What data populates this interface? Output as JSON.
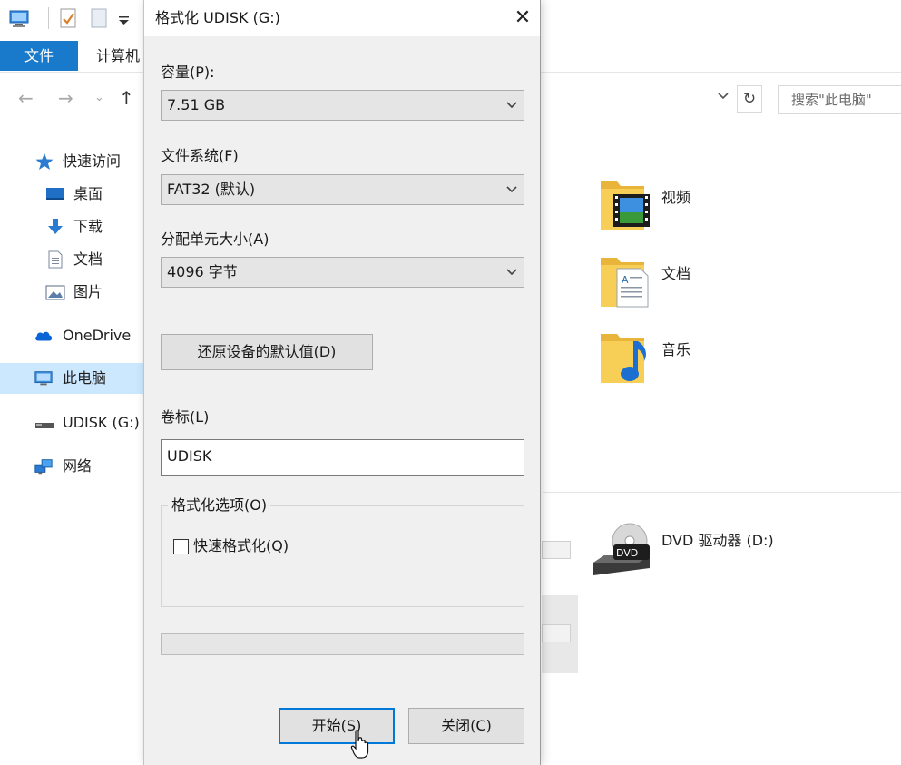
{
  "explorer": {
    "ribbon": {
      "file_tab": "文件",
      "computer_tab": "计算机"
    },
    "search": {
      "placeholder": "搜索\"此电脑\""
    },
    "sidebar": {
      "items": [
        {
          "label": "快速访问",
          "icon": "star-icon"
        },
        {
          "label": "桌面",
          "icon": "desktop-icon"
        },
        {
          "label": "下载",
          "icon": "download-arrow-icon"
        },
        {
          "label": "文档",
          "icon": "document-icon"
        },
        {
          "label": "图片",
          "icon": "picture-icon"
        },
        {
          "label": "OneDrive",
          "icon": "cloud-icon"
        },
        {
          "label": "此电脑",
          "icon": "computer-icon"
        },
        {
          "label": "UDISK (G:)",
          "icon": "usb-drive-icon"
        },
        {
          "label": "网络",
          "icon": "network-icon"
        }
      ]
    },
    "folders": [
      {
        "label": "视频",
        "icon": "video-folder-icon"
      },
      {
        "label": "文档",
        "icon": "documents-folder-icon"
      },
      {
        "label": "音乐",
        "icon": "music-folder-icon"
      }
    ],
    "drives": [
      {
        "label": "DVD 驱动器 (D:)",
        "icon": "dvd-drive-icon",
        "badge": "DVD"
      }
    ]
  },
  "dialog": {
    "title": "格式化 UDISK (G:)",
    "close_glyph": "✕",
    "capacity": {
      "label": "容量(P):",
      "value": "7.51 GB"
    },
    "filesystem": {
      "label": "文件系统(F)",
      "value": "FAT32 (默认)"
    },
    "allocation": {
      "label": "分配单元大小(A)",
      "value": "4096 字节"
    },
    "restore_button": "还原设备的默认值(D)",
    "volume_label": {
      "label": "卷标(L)",
      "value": "UDISK"
    },
    "options": {
      "legend": "格式化选项(O)",
      "quick_format": "快速格式化(Q)",
      "quick_format_checked": false
    },
    "progress": 0,
    "start_button": "开始(S)",
    "close_button": "关闭(C)"
  },
  "colors": {
    "accent": "#1979ca",
    "focus": "#0078d7",
    "selected": "#cce8ff",
    "dialog_bg": "#f0f0f0"
  }
}
